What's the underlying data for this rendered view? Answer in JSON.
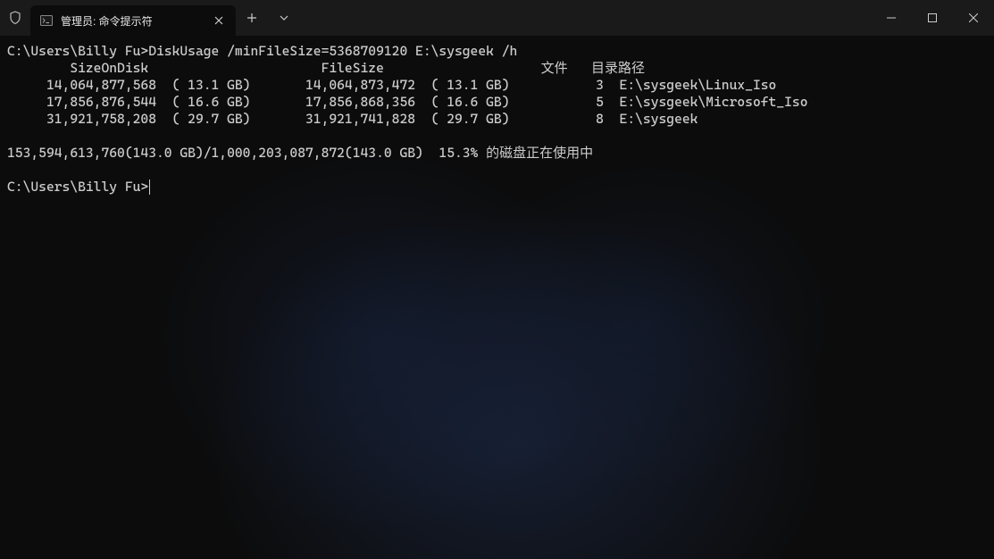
{
  "titlebar": {
    "tab_title": "管理员: 命令提示符"
  },
  "output": {
    "prompt1": "C:\\Users\\Billy Fu>",
    "command": "DiskUsage /minFileSize=5368709120 E:\\sysgeek /h",
    "header": "        SizeOnDisk                      FileSize                    文件   目录路径",
    "rows": [
      "     14,064,877,568  ( 13.1 GB)       14,064,873,472  ( 13.1 GB)           3  E:\\sysgeek\\Linux_Iso",
      "     17,856,876,544  ( 16.6 GB)       17,856,868,356  ( 16.6 GB)           5  E:\\sysgeek\\Microsoft_Iso",
      "     31,921,758,208  ( 29.7 GB)       31,921,741,828  ( 29.7 GB)           8  E:\\sysgeek"
    ],
    "summary": "153,594,613,760(143.0 GB)/1,000,203,087,872(143.0 GB)  15.3% 的磁盘正在使用中",
    "prompt2": "C:\\Users\\Billy Fu>"
  }
}
